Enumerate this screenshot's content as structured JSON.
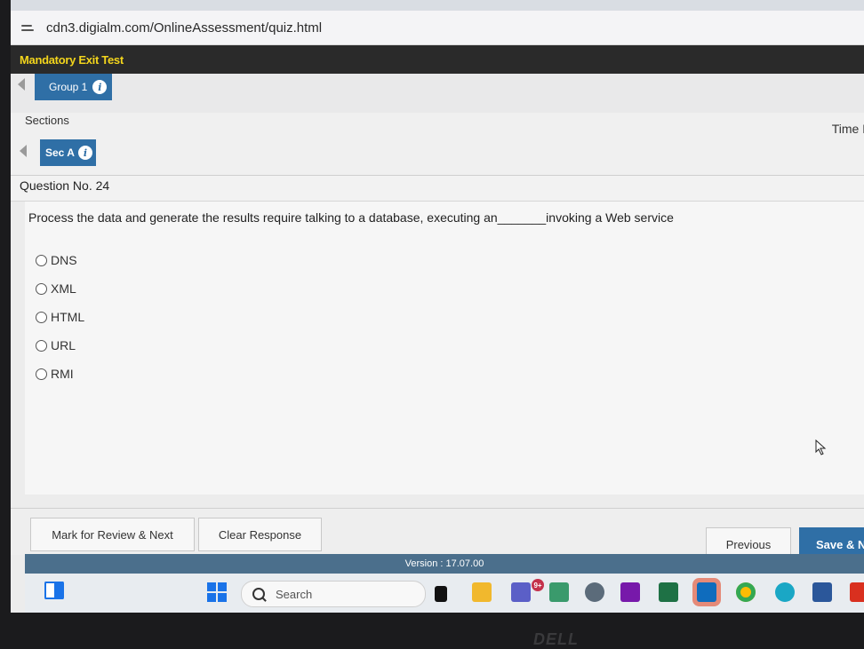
{
  "browser": {
    "url": "cdn3.digialm.com/OnlineAssessment/quiz.html"
  },
  "exam": {
    "title": "Mandatory Exit Test"
  },
  "group": {
    "label": "Group 1",
    "info_glyph": "i"
  },
  "sections": {
    "label": "Sections",
    "time_label": "Time L"
  },
  "section": {
    "label": "Sec A",
    "info_glyph": "i"
  },
  "question": {
    "number_label": "Question No. 24",
    "text": "Process the data and generate the results require talking to a database, executing an_______invoking a Web service",
    "options": [
      "DNS",
      "XML",
      "HTML",
      "URL",
      "RMI"
    ]
  },
  "buttons": {
    "mark_review": "Mark for Review & Next",
    "clear": "Clear Response",
    "previous": "Previous",
    "save": "Save & N"
  },
  "footer": {
    "version": "Version : 17.07.00"
  },
  "taskbar": {
    "search_placeholder": "Search",
    "teams_badge": "9+"
  },
  "device": {
    "brand": "DELL"
  },
  "colors": {
    "accent": "#2f6fa6",
    "title": "#f3d51c"
  }
}
